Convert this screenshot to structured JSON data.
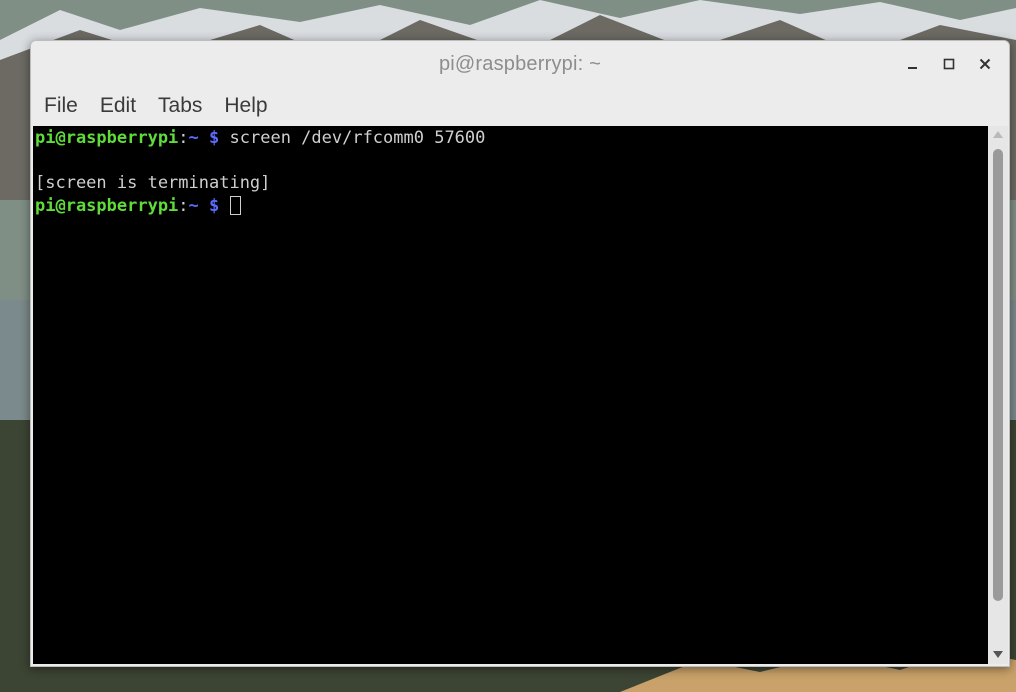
{
  "window": {
    "title": "pi@raspberrypi: ~"
  },
  "controls": {
    "minimize_icon": "minimize-icon",
    "maximize_icon": "maximize-icon",
    "close_icon": "close-icon"
  },
  "menu": {
    "items": [
      {
        "label": "File"
      },
      {
        "label": "Edit"
      },
      {
        "label": "Tabs"
      },
      {
        "label": "Help"
      }
    ]
  },
  "terminal": {
    "lines": [
      {
        "user": "pi@raspberrypi",
        "colon": ":",
        "path": "~",
        "dollar": " $",
        "cmd": " screen /dev/rfcomm0 57600"
      },
      {
        "text": ""
      },
      {
        "text": "[screen is terminating]"
      },
      {
        "user": "pi@raspberrypi",
        "colon": ":",
        "path": "~",
        "dollar": " $",
        "cmd": " "
      }
    ]
  },
  "colors": {
    "prompt_user": "#5fdc3a",
    "prompt_path": "#5c6cff",
    "terminal_bg": "#000000"
  }
}
